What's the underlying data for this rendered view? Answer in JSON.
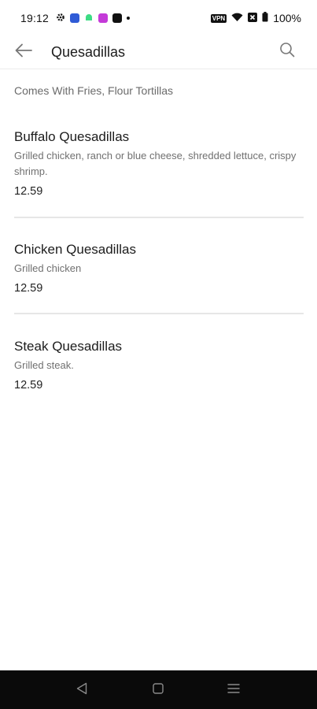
{
  "status_bar": {
    "time": "19:12",
    "battery": "100%",
    "vpn_label": "VPN",
    "left_icons": [
      "gear-icon",
      "app-icon-blue",
      "android-icon",
      "app-icon-pink",
      "app-icon-black",
      "dot-icon"
    ],
    "right_icons": [
      "vpn-icon",
      "wifi-icon",
      "signal-x-icon",
      "battery-icon"
    ]
  },
  "app_bar": {
    "title": "Quesadillas",
    "back_icon": "back-arrow-icon",
    "search_icon": "search-icon"
  },
  "menu": {
    "subtitle": "Comes With Fries, Flour Tortillas",
    "items": [
      {
        "name": "Buffalo Quesadillas",
        "description": "Grilled chicken, ranch or blue cheese, shredded lettuce, crispy shrimp.",
        "price": "12.59"
      },
      {
        "name": "Chicken Quesadillas",
        "description": "Grilled chicken",
        "price": "12.59"
      },
      {
        "name": "Steak Quesadillas",
        "description": "Grilled steak.",
        "price": "12.59"
      }
    ]
  },
  "nav_bar": {
    "icons": [
      "nav-back-icon",
      "nav-home-icon",
      "nav-menu-icon"
    ]
  },
  "colors": {
    "background": "#ffffff",
    "text_primary": "#1c1c1c",
    "text_secondary": "#707070",
    "divider": "#e6e6e6",
    "nav_bar": "#0a0a0a"
  }
}
